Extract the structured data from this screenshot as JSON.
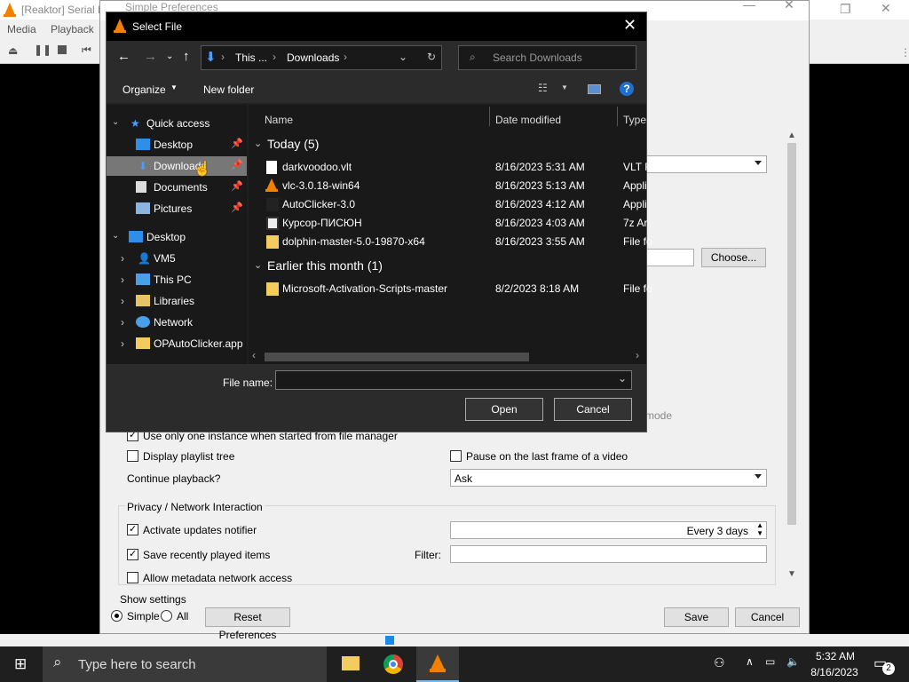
{
  "vlc": {
    "title": "[Reaktor] Serial E",
    "menu": [
      "Media",
      "Playback"
    ]
  },
  "prefs": {
    "title": "Simple Preferences",
    "choose_btn": "Choose...",
    "mode_tail": "mode",
    "one_instance": "Use only one instance when started from file manager",
    "display_tree": "Display playlist tree",
    "pause_last": "Pause on the last frame of a video",
    "continue_label": "Continue playback?",
    "continue_value": "Ask",
    "privacy_group": "Privacy / Network Interaction",
    "updates_label": "Activate updates notifier",
    "updates_value": "Every 3 days",
    "save_recent": "Save recently played items",
    "filter_label": "Filter:",
    "metadata": "Allow metadata network access",
    "show_settings": "Show settings",
    "simple": "Simple",
    "all": "All",
    "reset": "Reset Preferences",
    "save": "Save",
    "cancel": "Cancel"
  },
  "dialog": {
    "title": "Select File",
    "address": {
      "part1": "This ...",
      "part2": "Downloads"
    },
    "search_placeholder": "Search Downloads",
    "organize": "Organize",
    "new_folder": "New folder",
    "tree": [
      {
        "label": "Quick access",
        "icon": "star-icon"
      },
      {
        "label": "Desktop",
        "icon": "desktop-icon"
      },
      {
        "label": "Downloads",
        "icon": "download-icon"
      },
      {
        "label": "Documents",
        "icon": "documents-icon"
      },
      {
        "label": "Pictures",
        "icon": "pictures-icon"
      },
      {
        "label": "Desktop",
        "icon": "desktop-icon"
      },
      {
        "label": "VM5",
        "icon": "user-icon"
      },
      {
        "label": "This PC",
        "icon": "computer-icon"
      },
      {
        "label": "Libraries",
        "icon": "libraries-icon"
      },
      {
        "label": "Network",
        "icon": "network-icon"
      },
      {
        "label": "OPAutoClicker.app",
        "icon": "folder-icon"
      }
    ],
    "columns": {
      "name": "Name",
      "date": "Date modified",
      "type": "Type"
    },
    "groups": [
      {
        "label": "Today (5)",
        "rows": [
          {
            "name": "darkvoodoo.vlt",
            "date": "8/16/2023 5:31 AM",
            "type": "VLT F",
            "icon": "file-icon"
          },
          {
            "name": "vlc-3.0.18-win64",
            "date": "8/16/2023 5:13 AM",
            "type": "Appli",
            "icon": "vlc-icon"
          },
          {
            "name": "AutoClicker-3.0",
            "date": "8/16/2023 4:12 AM",
            "type": "Appli",
            "icon": "app-icon"
          },
          {
            "name": "Курсор-ПИСЮН",
            "date": "8/16/2023 4:03 AM",
            "type": "7z Ar",
            "icon": "archive-icon"
          },
          {
            "name": "dolphin-master-5.0-19870-x64",
            "date": "8/16/2023 3:55 AM",
            "type": "File fo",
            "icon": "folder-icon"
          }
        ]
      },
      {
        "label": "Earlier this month (1)",
        "rows": [
          {
            "name": "Microsoft-Activation-Scripts-master",
            "date": "8/2/2023 8:18 AM",
            "type": "File fo",
            "icon": "folder-icon"
          }
        ]
      }
    ],
    "filename_label": "File name:",
    "filename_value": "",
    "open": "Open",
    "cancel": "Cancel"
  },
  "taskbar": {
    "search_placeholder": "Type here to search",
    "time": "5:32 AM",
    "date": "8/16/2023",
    "notif_count": "2"
  }
}
